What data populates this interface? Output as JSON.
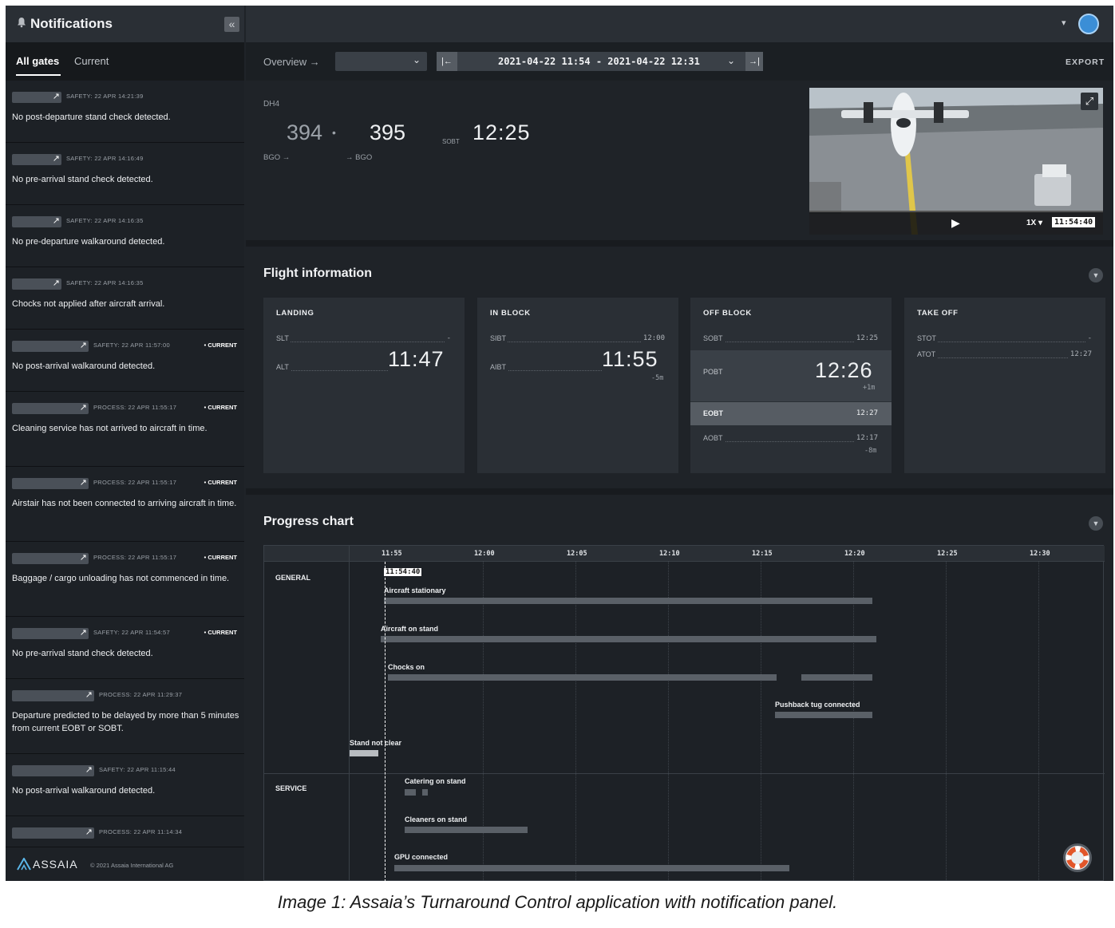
{
  "notifications": {
    "title": "Notifications",
    "collapse_icon": "«",
    "tabs": {
      "all": "All gates",
      "current": "Current"
    },
    "items": [
      {
        "meta": "SAFETY: 22 APR 14:21:39",
        "current": "",
        "message": "No post-departure stand check detected."
      },
      {
        "meta": "SAFETY: 22 APR 14:16:49",
        "current": "",
        "message": "No pre-arrival stand check detected."
      },
      {
        "meta": "SAFETY: 22 APR 14:16:35",
        "current": "",
        "message": "No pre-departure walkaround detected."
      },
      {
        "meta": "SAFETY: 22 APR 14:16:35",
        "current": "",
        "message": "Chocks not applied after aircraft arrival."
      },
      {
        "meta": "SAFETY: 22 APR 11:57:00",
        "current": "• CURRENT",
        "message": "No post-arrival walkaround detected."
      },
      {
        "meta": "PROCESS: 22 APR 11:55:17",
        "current": "• CURRENT",
        "message": "Cleaning service has not arrived to aircraft in time."
      },
      {
        "meta": "PROCESS: 22 APR 11:55:17",
        "current": "• CURRENT",
        "message": "Airstair has not been connected to arriving aircraft in time."
      },
      {
        "meta": "PROCESS: 22 APR 11:55:17",
        "current": "• CURRENT",
        "message": "Baggage / cargo unloading has not commenced in time."
      },
      {
        "meta": "SAFETY: 22 APR 11:54:57",
        "current": "• CURRENT",
        "message": "No pre-arrival stand check detected."
      },
      {
        "meta": "PROCESS: 22 APR 11:29:37",
        "current": "",
        "message": "Departure predicted to be delayed by more than 5 minutes from current EOBT or SOBT."
      },
      {
        "meta": "SAFETY: 22 APR 11:15:44",
        "current": "",
        "message": "No post-arrival walkaround detected."
      },
      {
        "meta": "PROCESS: 22 APR 11:14:34",
        "current": "",
        "message": ""
      }
    ],
    "footer": {
      "logo": "ASSAIA",
      "copyright": "© 2021 Assaia International AG"
    }
  },
  "nav": {
    "overview": "Overview →",
    "date_range": "2021-04-22 11:54 - 2021-04-22 12:31",
    "first_icon": "|←",
    "last_icon": "→|",
    "export": "EXPORT"
  },
  "flight": {
    "gate": "DH4",
    "arrival_number": "394",
    "separator": "•",
    "departure_number": "395",
    "sobt_label": "SOBT",
    "sobt_time": "12:25",
    "arrival_route": "BGO →",
    "departure_route": "→ BGO"
  },
  "video": {
    "speed": "1X ▾",
    "time": "11:54:40",
    "play_icon": "▶",
    "expand_icon": "⤢"
  },
  "flight_info": {
    "title": "Flight information",
    "landing": {
      "title": "LANDING",
      "slt_label": "SLT",
      "slt_value": "-",
      "alt_label": "ALT",
      "alt_time": "11:47"
    },
    "in_block": {
      "title": "IN BLOCK",
      "sibt_label": "SIBT",
      "sibt_value": "12:00",
      "aibt_label": "AIBT",
      "aibt_time": "11:55",
      "aibt_delta": "-5m"
    },
    "off_block": {
      "title": "OFF BLOCK",
      "sobt_label": "SOBT",
      "sobt_value": "12:25",
      "pobt_label": "POBT",
      "pobt_time": "12:26",
      "pobt_delta": "+1m",
      "eobt_label": "EOBT",
      "eobt_value": "12:27",
      "aobt_label": "AOBT",
      "aobt_value": "12:17",
      "aobt_delta": "-8m"
    },
    "take_off": {
      "title": "TAKE OFF",
      "stot_label": "STOT",
      "stot_value": "-",
      "atot_label": "ATOT",
      "atot_value": "12:27"
    }
  },
  "progress": {
    "title": "Progress chart",
    "ticks": [
      "11:55",
      "12:00",
      "12:05",
      "12:10",
      "12:15",
      "12:20",
      "12:25",
      "12:30"
    ],
    "now_time": "11:54:40",
    "groups": [
      {
        "name": "GENERAL",
        "tasks": [
          {
            "label": "Aircraft stationary"
          },
          {
            "label": "Aircraft on stand"
          },
          {
            "label": "Chocks on"
          },
          {
            "label": "Pushback tug connected"
          },
          {
            "label": "Stand not clear"
          }
        ]
      },
      {
        "name": "SERVICE",
        "tasks": [
          {
            "label": "Catering on stand"
          },
          {
            "label": "Cleaners on stand"
          },
          {
            "label": "GPU connected"
          }
        ]
      }
    ]
  },
  "caption": "Image 1: Assaia’s Turnaround Control application with notification panel."
}
